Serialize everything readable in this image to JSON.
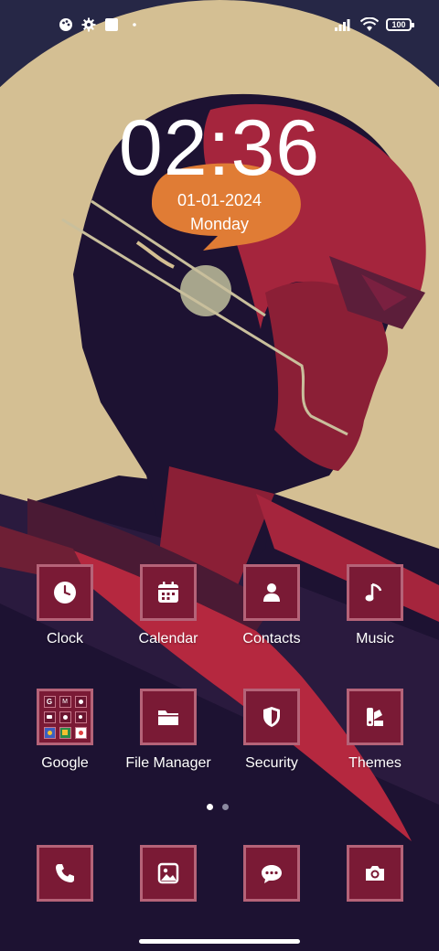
{
  "colors": {
    "sky": "#262746",
    "sun": "#d4bf93",
    "figure": "#1d1232",
    "crimson": "#a5253d",
    "maroon": "#6e1f35",
    "orange": "#e07c35",
    "sage": "#a7a58c",
    "tile_fill": "#7a1a35",
    "tile_border": "#b56378"
  },
  "status_bar": {
    "left_icons": [
      "palette-icon",
      "gear-icon",
      "square-app-icon",
      "dot-icon"
    ],
    "right_icons": [
      "signal-icon",
      "wifi-icon",
      "battery-icon"
    ],
    "battery_level": "100"
  },
  "lockclock": {
    "time": "02:36",
    "date": "01-01-2024",
    "day": "Monday"
  },
  "apps": [
    {
      "label": "Clock",
      "icon": "clock-icon"
    },
    {
      "label": "Calendar",
      "icon": "calendar-icon"
    },
    {
      "label": "Contacts",
      "icon": "contact-person-icon"
    },
    {
      "label": "Music",
      "icon": "music-note-icon"
    },
    {
      "label": "Google",
      "icon": "google-folder-icon"
    },
    {
      "label": "File Manager",
      "icon": "folder-icon"
    },
    {
      "label": "Security",
      "icon": "shield-icon"
    },
    {
      "label": "Themes",
      "icon": "themes-icon"
    }
  ],
  "pager": {
    "pages": 2,
    "current": 1
  },
  "dock": [
    {
      "icon": "phone-icon"
    },
    {
      "icon": "gallery-icon"
    },
    {
      "icon": "messages-icon"
    },
    {
      "icon": "camera-icon"
    }
  ]
}
